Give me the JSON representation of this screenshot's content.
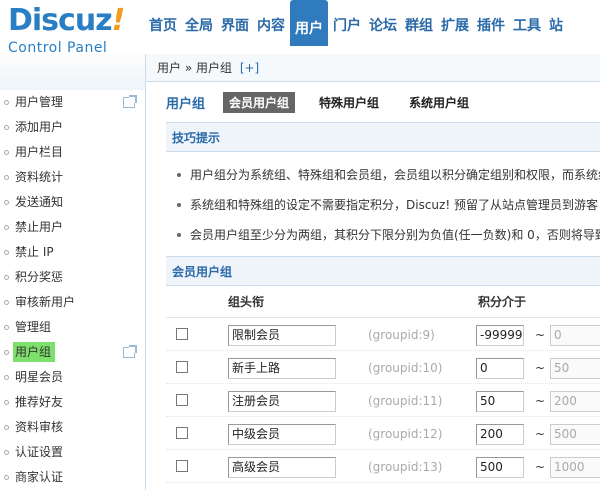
{
  "logo": {
    "main": "Discuz",
    "bang": "!",
    "sub": "Control Panel"
  },
  "topnav": [
    {
      "label": "首页"
    },
    {
      "label": "全局"
    },
    {
      "label": "界面"
    },
    {
      "label": "内容"
    },
    {
      "label": "用户"
    },
    {
      "label": "门户"
    },
    {
      "label": "论坛"
    },
    {
      "label": "群组"
    },
    {
      "label": "扩展"
    },
    {
      "label": "插件"
    },
    {
      "label": "工具"
    },
    {
      "label": "站"
    }
  ],
  "sidebar": [
    {
      "label": "用户管理"
    },
    {
      "label": "添加用户"
    },
    {
      "label": "用户栏目"
    },
    {
      "label": "资料统计"
    },
    {
      "label": "发送通知"
    },
    {
      "label": "禁止用户"
    },
    {
      "label": "禁止 IP"
    },
    {
      "label": "积分奖惩"
    },
    {
      "label": "审核新用户"
    },
    {
      "label": "管理组"
    },
    {
      "label": "用户组"
    },
    {
      "label": "明星会员"
    },
    {
      "label": "推荐好友"
    },
    {
      "label": "资料审核"
    },
    {
      "label": "认证设置"
    },
    {
      "label": "商家认证"
    }
  ],
  "breadcrumb": {
    "text": "用户 » 用户组",
    "plus": "[+]"
  },
  "page": {
    "title": "用户组",
    "tabs": [
      {
        "label": "会员用户组"
      },
      {
        "label": "特殊用户组"
      },
      {
        "label": "系统用户组"
      }
    ]
  },
  "tips": {
    "heading": "技巧提示",
    "items": [
      "用户组分为系统组、特殊组和会员组，会员组以积分确定组别和权限，而系统组",
      "系统组和特殊组的设定不需要指定积分，Discuz! 预留了从站点管理员到游客",
      "会员用户组至少分为两组，其积分下限分别为负值(任一负数)和 0，否则将导致"
    ]
  },
  "groups": {
    "heading": "会员用户组",
    "col_title": "组头衔",
    "col_range": "积分介于",
    "tilde": "~",
    "rows": [
      {
        "name": "限制会员",
        "gid": "(groupid:9)",
        "lo": "-999999",
        "hi": "0"
      },
      {
        "name": "新手上路",
        "gid": "(groupid:10)",
        "lo": "0",
        "hi": "50"
      },
      {
        "name": "注册会员",
        "gid": "(groupid:11)",
        "lo": "50",
        "hi": "200"
      },
      {
        "name": "中级会员",
        "gid": "(groupid:12)",
        "lo": "200",
        "hi": "500"
      },
      {
        "name": "高级会员",
        "gid": "(groupid:13)",
        "lo": "500",
        "hi": "1000"
      }
    ]
  }
}
